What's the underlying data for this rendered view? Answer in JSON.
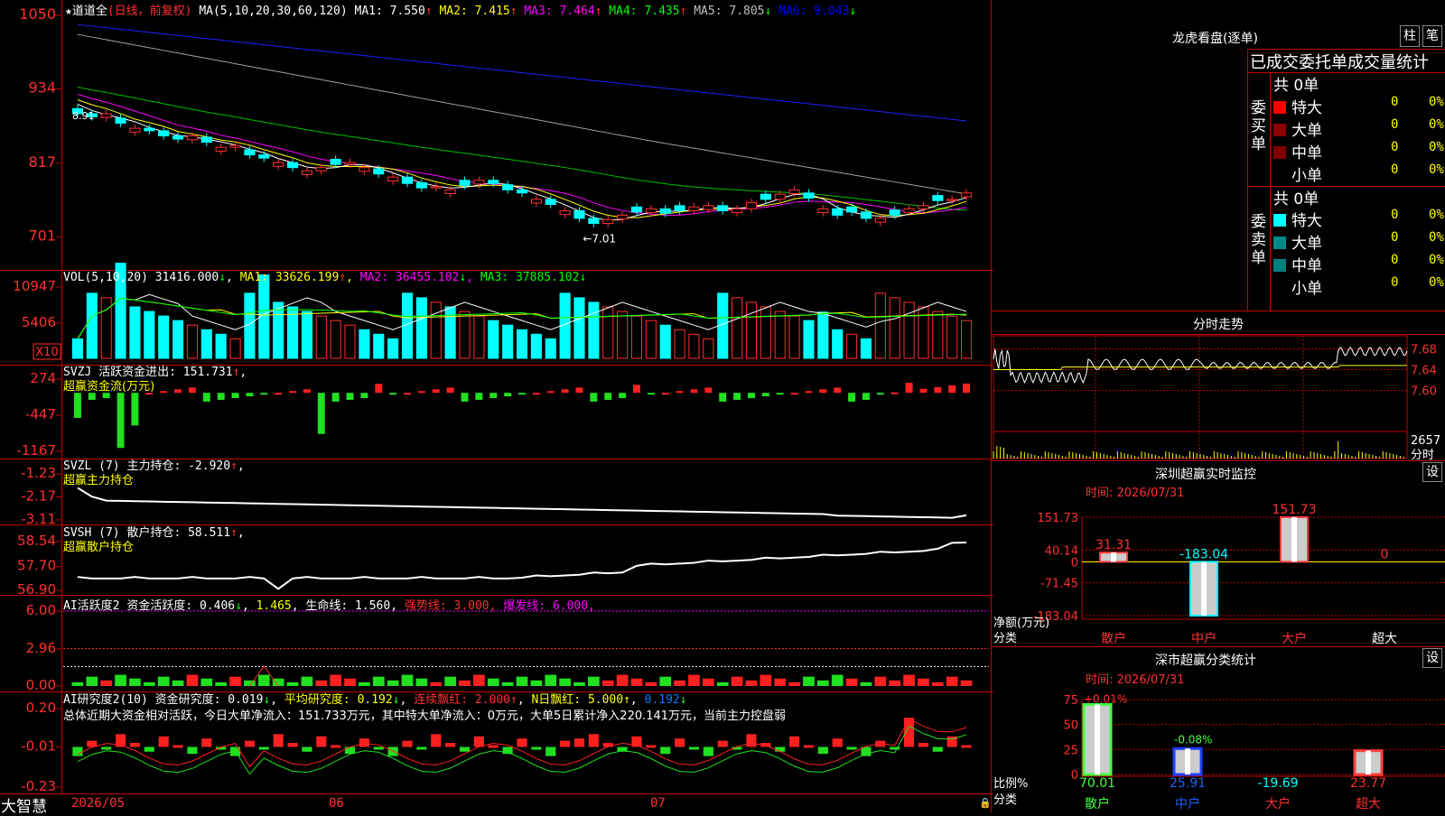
{
  "window": {
    "brand": "大智慧",
    "kline_dates": [
      "2026/05",
      "06",
      "07"
    ]
  },
  "main_chart": {
    "title": "道道全",
    "mode": "(日线，前复权)",
    "ma_params": "MA(5,10,20,30,60,120)",
    "ma_legend": [
      {
        "name": "MA1",
        "value": "7.550",
        "arrow": "↑",
        "color": "#ffffff"
      },
      {
        "name": "MA2",
        "value": "7.415",
        "arrow": "↑",
        "color": "#ffff00"
      },
      {
        "name": "MA3",
        "value": "7.464",
        "arrow": "↑",
        "color": "#ff00ff"
      },
      {
        "name": "MA4",
        "value": "7.435",
        "arrow": "↑",
        "color": "#00ff00"
      },
      {
        "name": "MA5",
        "value": "7.805",
        "arrow": "↓",
        "color": "#c0c0c0"
      },
      {
        "name": "MA6",
        "value": "9.043",
        "arrow": "↓",
        "color": "#0000ff"
      }
    ],
    "y_ticks": [
      "1050",
      "934",
      "817",
      "701"
    ],
    "low_marker": "←7.01",
    "high_marker": "8.91"
  },
  "vol_chart": {
    "label": "VOL(5,10,20)",
    "value": "31416.000",
    "ma": [
      {
        "name": "MA1",
        "value": "33626.199",
        "arrow": "↑"
      },
      {
        "name": "MA2",
        "value": "36455.102",
        "arrow": "↓"
      },
      {
        "name": "MA3",
        "value": "37885.102",
        "arrow": "↓"
      }
    ],
    "y_ticks": [
      "10947",
      "5406"
    ],
    "unit": "X10"
  },
  "svzj": {
    "label": "SVZJ",
    "desc": "活跃资金进出:",
    "value": "151.731",
    "arrow": "↑",
    "name": "超赢资金流(万元)",
    "y_ticks": [
      "274",
      "-447",
      "-1167"
    ]
  },
  "svzl": {
    "label": "SVZL (7)",
    "desc": "主力持仓:",
    "value": "-2.920",
    "arrow": "↑",
    "name": "超赢主力持仓",
    "y_ticks": [
      "-1.23",
      "-2.17",
      "-3.11"
    ]
  },
  "svsh": {
    "label": "SVSH (7)",
    "desc": "散户持仓:",
    "value": "58.511",
    "arrow": "↑",
    "name": "超赢散户持仓",
    "y_ticks": [
      "58.54",
      "57.70",
      "56.90"
    ]
  },
  "ai_active": {
    "label": "AI活跃度2",
    "desc": "资金活跃度:",
    "value": "0.406",
    "v2": "1.465",
    "life_label": "生命线:",
    "life": "1.560",
    "strong_label": "强势线:",
    "strong": "3.000",
    "burst_label": "爆发线:",
    "burst": "6.000",
    "y_ticks": [
      "6.00",
      "2.96",
      "0.00"
    ]
  },
  "ai_research": {
    "label": "AI研究度2(10)",
    "desc": "资金研究度:",
    "value": "0.019",
    "avg_label": "平均研究度:",
    "avg": "0.192",
    "cont_label": "连续飘红:",
    "cont": "2.000",
    "n_label": "N日飘红:",
    "n": "5.000",
    "last": "0.192",
    "summary": "总体近期大资金相对活跃，今日大单净流入：151.733万元，其中特大单净流入：0万元，大单5日累计净入220.141万元，当前主力控盘弱",
    "y_ticks": [
      "0.20",
      "-0.01",
      "-0.23"
    ]
  },
  "side": {
    "title": "龙虎看盘(逐单)",
    "btn_bar": "柱",
    "btn_pen": "笔",
    "stats_header": "已成交委托单成交量统计",
    "buy_label": "委买单",
    "sell_label": "委卖单",
    "buy_total": "共 0单",
    "sell_total": "共 0单",
    "buy_rows": [
      {
        "name": "特大",
        "count": "0",
        "pct": "0%",
        "color": "#ff0000"
      },
      {
        "name": "大单",
        "count": "0",
        "pct": "0%",
        "color": "#8b0000"
      },
      {
        "name": "中单",
        "count": "0",
        "pct": "0%",
        "color": "#800000"
      },
      {
        "name": "小单",
        "count": "0",
        "pct": "0%",
        "color": ""
      }
    ],
    "sell_rows": [
      {
        "name": "特大",
        "count": "0",
        "pct": "0%",
        "color": "#00ffff"
      },
      {
        "name": "大单",
        "count": "0",
        "pct": "0%",
        "color": "#008b8b"
      },
      {
        "name": "中单",
        "count": "0",
        "pct": "0%",
        "color": "#008080"
      },
      {
        "name": "小单",
        "count": "0",
        "pct": "0%",
        "color": ""
      }
    ],
    "intraday": {
      "title": "分时走势",
      "y_ticks": [
        "7.68",
        "7.64",
        "7.60"
      ],
      "vol": "2657",
      "vol_unit": "分时"
    },
    "monitor": {
      "title": "深圳超赢实时监控",
      "btn": "设",
      "time": "时间: 2026/07/31",
      "y_ticks": [
        "151.73",
        "40.14",
        "0",
        "-71.45",
        "-183.04"
      ],
      "y_label": "净额(万元)",
      "x_label": "分类",
      "categories": [
        "散户",
        "中户",
        "大户",
        "超大"
      ],
      "values": [
        31.31,
        -183.04,
        151.73,
        0
      ],
      "value_labels": [
        "31.31",
        "-183.04",
        "151.73",
        "0"
      ]
    },
    "classify": {
      "title": "深市超赢分类统计",
      "btn": "设",
      "time": "时间: 2026/07/31",
      "y_ticks": [
        "75",
        "50",
        "25",
        "0"
      ],
      "y_label": "比例%",
      "x_label": "分类",
      "categories": [
        "散户",
        "中户",
        "大户",
        "超大"
      ],
      "values": [
        70.01,
        25.91,
        -19.69,
        23.77
      ],
      "value_labels": [
        "70.01",
        "25.91",
        "-19.69",
        "23.77"
      ],
      "change_labels": [
        "+0.01%",
        "-0.08%"
      ]
    }
  },
  "chart_data": [
    {
      "type": "candlestick",
      "title": "道道全",
      "ylim": [
        6.9,
        10.6
      ],
      "y_ticks": [
        "1050",
        "934",
        "817",
        "701"
      ],
      "x_labels": [
        "2026/05",
        "06",
        "07"
      ],
      "ma_last": {
        "MA1": 7.55,
        "MA2": 7.415,
        "MA3": 7.464,
        "MA4": 7.435,
        "MA5": 7.805,
        "MA6": 9.043
      },
      "close": [
        8.95,
        8.9,
        8.95,
        8.8,
        8.72,
        8.68,
        8.6,
        8.55,
        8.6,
        8.5,
        8.42,
        8.45,
        8.3,
        8.25,
        8.18,
        8.1,
        8.05,
        8.1,
        8.15,
        8.18,
        8.1,
        8.0,
        7.95,
        7.85,
        7.78,
        7.8,
        7.75,
        7.82,
        7.9,
        7.85,
        7.75,
        7.7,
        7.6,
        7.52,
        7.42,
        7.3,
        7.22,
        7.28,
        7.35,
        7.4,
        7.45,
        7.38,
        7.42,
        7.48,
        7.5,
        7.42,
        7.45,
        7.55,
        7.6,
        7.68,
        7.75,
        7.62,
        7.45,
        7.35,
        7.4,
        7.3,
        7.3,
        7.35,
        7.45,
        7.5,
        7.58,
        7.6,
        7.7
      ],
      "low_marker": 7.01
    },
    {
      "type": "bar",
      "title": "VOL(5,10,20)",
      "ylim": [
        0,
        10947
      ],
      "last": 31416.0
    },
    {
      "type": "bar",
      "title": "SVZJ 超赢资金流(万元)",
      "ylim": [
        -1167,
        274
      ],
      "last": 151.731
    },
    {
      "type": "line",
      "title": "SVZL 超赢主力持仓",
      "ylim": [
        -3.11,
        -1.23
      ],
      "last": -2.92
    },
    {
      "type": "line",
      "title": "SVSH 超赢散户持仓",
      "ylim": [
        56.9,
        58.54
      ],
      "last": 58.511
    },
    {
      "type": "bar",
      "title": "AI活跃度2",
      "ylim": [
        0,
        6.0
      ],
      "last": 0.406
    },
    {
      "type": "bar",
      "title": "AI研究度2(10)",
      "ylim": [
        -0.23,
        0.2
      ],
      "last": 0.019
    },
    {
      "type": "bar",
      "title": "深圳超赢实时监控",
      "categories": [
        "散户",
        "中户",
        "大户",
        "超大"
      ],
      "values": [
        31.31,
        -183.04,
        151.73,
        0
      ],
      "ylabel": "净额(万元)"
    },
    {
      "type": "bar",
      "title": "深市超赢分类统计",
      "categories": [
        "散户",
        "中户",
        "大户",
        "超大"
      ],
      "values": [
        70.01,
        25.91,
        -19.69,
        23.77
      ],
      "ylabel": "比例%"
    }
  ]
}
